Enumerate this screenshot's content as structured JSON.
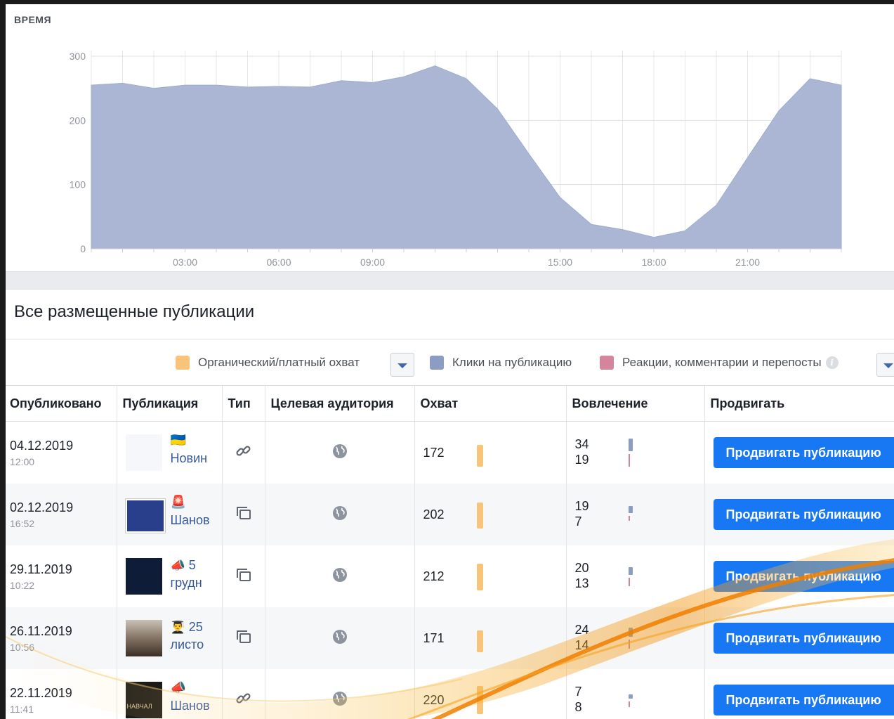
{
  "chart_section": {
    "label": "ВРЕМЯ"
  },
  "chart_data": {
    "type": "area",
    "title": "",
    "xlabel": "",
    "ylabel": "",
    "x_ticks": [
      "03:00",
      "06:00",
      "09:00",
      "15:00",
      "18:00",
      "21:00"
    ],
    "y_ticks": [
      "0",
      "100",
      "200",
      "300"
    ],
    "ylim": [
      0,
      300
    ],
    "xlim": [
      0,
      24
    ],
    "grid": true,
    "series": [
      {
        "color": "#aab6d3",
        "x": [
          0,
          1,
          2,
          3,
          4,
          5,
          6,
          7,
          8,
          9,
          10,
          11,
          12,
          13,
          14,
          15,
          16,
          17,
          18,
          19,
          20,
          21,
          22,
          23,
          24
        ],
        "values": [
          255,
          258,
          250,
          255,
          255,
          252,
          253,
          252,
          262,
          259,
          268,
          285,
          265,
          218,
          148,
          80,
          38,
          30,
          18,
          28,
          68,
          142,
          215,
          265,
          255
        ]
      }
    ]
  },
  "posts": {
    "title": "Все размещенные публикации",
    "legend": [
      {
        "label": "Органический/платный охват",
        "color": "#f7c47a"
      },
      {
        "label": "Клики на публикацию",
        "color": "#8b9dc3"
      },
      {
        "label": "Реакции, комментарии и перепосты",
        "color": "#d3869b"
      }
    ],
    "columns": [
      "Опубликовано",
      "Публикация",
      "Тип",
      "Целевая аудитория",
      "Охват",
      "Вовлечение",
      "Продвигать"
    ],
    "rows": [
      {
        "date": "04.12.2019",
        "time": "12:00",
        "emoji": "🇺🇦",
        "pub_text": "Новин",
        "type": "link",
        "audience": "globe",
        "reach": "172",
        "reach_frac": 0.78,
        "clicks": "34",
        "reactions": "19",
        "promote": "Продвигать публикацию",
        "thumb": "blank"
      },
      {
        "date": "02.12.2019",
        "time": "16:52",
        "emoji": "🚨",
        "pub_text": "Шанов",
        "type": "album",
        "audience": "globe",
        "reach": "202",
        "reach_frac": 0.92,
        "clicks": "19",
        "reactions": "7",
        "promote": "Продвигать публикацию",
        "thumb": "blue"
      },
      {
        "date": "29.11.2019",
        "time": "10:22",
        "emoji": "📣",
        "pub_text": "5",
        "pub_text2": "грудн",
        "type": "album",
        "audience": "globe",
        "reach": "212",
        "reach_frac": 0.96,
        "clicks": "20",
        "reactions": "13",
        "promote": "Продвигать публикацию",
        "thumb": "dark"
      },
      {
        "date": "26.11.2019",
        "time": "10:56",
        "emoji": "👨‍🎓",
        "pub_text": "25",
        "pub_text2": "листо",
        "type": "album",
        "audience": "globe",
        "reach": "171",
        "reach_frac": 0.78,
        "clicks": "24",
        "reactions": "14",
        "promote": "Продвигать публикацию",
        "thumb": "photo"
      },
      {
        "date": "22.11.2019",
        "time": "11:41",
        "emoji": "📣",
        "pub_text": "Шанов",
        "type": "link",
        "audience": "globe",
        "reach": "220",
        "reach_frac": 1.0,
        "clicks": "7",
        "reactions": "8",
        "promote": "Продвигать публикацию",
        "thumb": "black",
        "thumb_text": "НАВЧАЛ"
      }
    ]
  }
}
